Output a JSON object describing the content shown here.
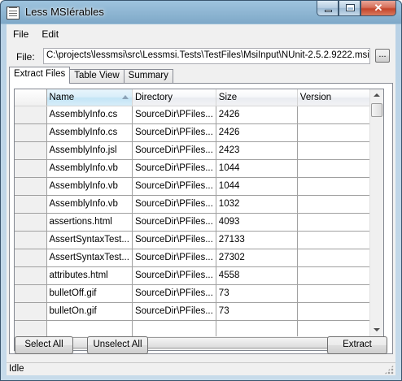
{
  "window": {
    "title": "Less MSIérables",
    "close_glyph": "✕"
  },
  "menu": {
    "items": [
      {
        "label": "File"
      },
      {
        "label": "Edit"
      }
    ]
  },
  "file_row": {
    "label": "File:",
    "path": "C:\\projects\\lessmsi\\src\\Lessmsi.Tests\\TestFiles\\MsiInput\\NUnit-2.5.2.9222.msi",
    "browse_label": "..."
  },
  "tabs": [
    {
      "label": "Extract Files"
    },
    {
      "label": "Table View"
    },
    {
      "label": "Summary"
    }
  ],
  "grid": {
    "columns": [
      {
        "label": "Name"
      },
      {
        "label": "Directory"
      },
      {
        "label": "Size"
      },
      {
        "label": "Version"
      }
    ],
    "sort_column": "Name",
    "sort_direction": "ascending",
    "rows": [
      {
        "name": "AssemblyInfo.cs",
        "directory": "SourceDir\\PFiles...",
        "size": "2426",
        "version": ""
      },
      {
        "name": "AssemblyInfo.cs",
        "directory": "SourceDir\\PFiles...",
        "size": "2426",
        "version": ""
      },
      {
        "name": "AssemblyInfo.jsl",
        "directory": "SourceDir\\PFiles...",
        "size": "2423",
        "version": ""
      },
      {
        "name": "AssemblyInfo.vb",
        "directory": "SourceDir\\PFiles...",
        "size": "1044",
        "version": ""
      },
      {
        "name": "AssemblyInfo.vb",
        "directory": "SourceDir\\PFiles...",
        "size": "1044",
        "version": ""
      },
      {
        "name": "AssemblyInfo.vb",
        "directory": "SourceDir\\PFiles...",
        "size": "1032",
        "version": ""
      },
      {
        "name": "assertions.html",
        "directory": "SourceDir\\PFiles...",
        "size": "4093",
        "version": ""
      },
      {
        "name": "AssertSyntaxTest...",
        "directory": "SourceDir\\PFiles...",
        "size": "27133",
        "version": ""
      },
      {
        "name": "AssertSyntaxTest...",
        "directory": "SourceDir\\PFiles...",
        "size": "27302",
        "version": ""
      },
      {
        "name": "attributes.html",
        "directory": "SourceDir\\PFiles...",
        "size": "4558",
        "version": ""
      },
      {
        "name": "bulletOff.gif",
        "directory": "SourceDir\\PFiles...",
        "size": "73",
        "version": ""
      },
      {
        "name": "bulletOn.gif",
        "directory": "SourceDir\\PFiles...",
        "size": "73",
        "version": ""
      },
      {
        "name": "",
        "directory": "",
        "size": "",
        "version": ""
      }
    ]
  },
  "buttons": {
    "select_all": "Select All",
    "unselect_all": "Unselect All",
    "extract": "Extract"
  },
  "status": {
    "text": "Idle"
  }
}
